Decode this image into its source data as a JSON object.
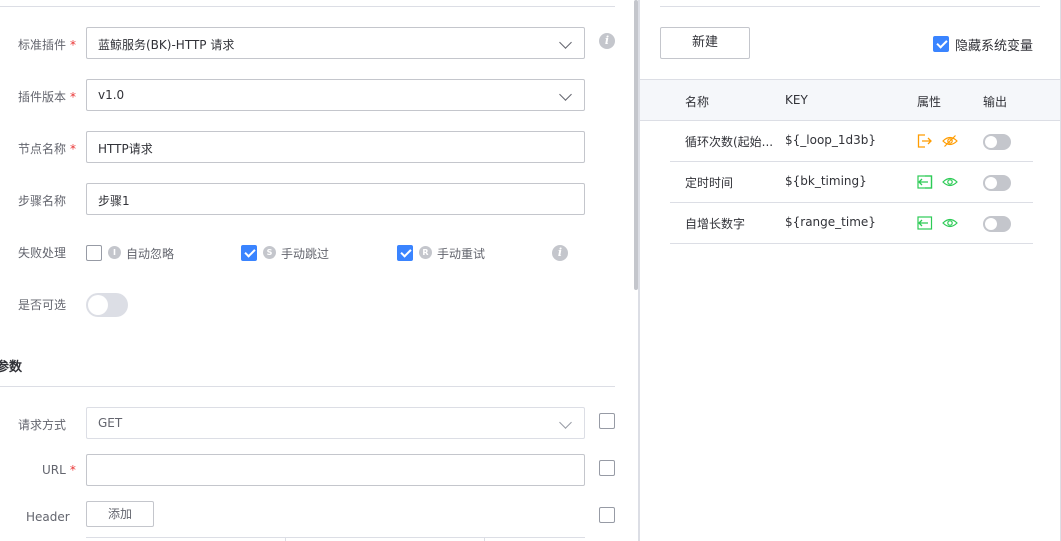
{
  "form": {
    "plugin": {
      "label": "标准插件",
      "required": "*",
      "value": "蓝鲸服务(BK)-HTTP 请求"
    },
    "version": {
      "label": "插件版本",
      "required": "*",
      "value": "v1.0"
    },
    "node_name": {
      "label": "节点名称",
      "required": "*",
      "value": "HTTP请求"
    },
    "step_name": {
      "label": "步骤名称",
      "value": "步骤1"
    },
    "failure": {
      "label": "失败处理",
      "options": [
        {
          "badge": "I",
          "label": "自动忽略",
          "checked": false
        },
        {
          "badge": "S",
          "label": "手动跳过",
          "checked": true
        },
        {
          "badge": "R",
          "label": "手动重试",
          "checked": true
        }
      ]
    },
    "optional": {
      "label": "是否可选",
      "on": false
    }
  },
  "params": {
    "section_title": "参数",
    "method": {
      "label": "请求方式",
      "value": "GET"
    },
    "url": {
      "label": "URL",
      "required": "*",
      "value": ""
    },
    "header": {
      "label": "Header",
      "add_button": "添加"
    }
  },
  "variables": {
    "new_button": "新建",
    "hide_system": {
      "label": "隐藏系统变量",
      "checked": true
    },
    "columns": [
      "名称",
      "KEY",
      "属性",
      "输出"
    ],
    "rows": [
      {
        "name": "循环次数(起始...",
        "key": "${_loop_1d3b}",
        "source": "output",
        "visible": false,
        "output": false,
        "color": "#ff9c01"
      },
      {
        "name": "定时时间",
        "key": "${bk_timing}",
        "source": "input",
        "visible": true,
        "output": false,
        "color": "#2dcb56"
      },
      {
        "name": "自增长数字",
        "key": "${range_time}",
        "source": "input",
        "visible": true,
        "output": false,
        "color": "#2dcb56"
      }
    ]
  }
}
